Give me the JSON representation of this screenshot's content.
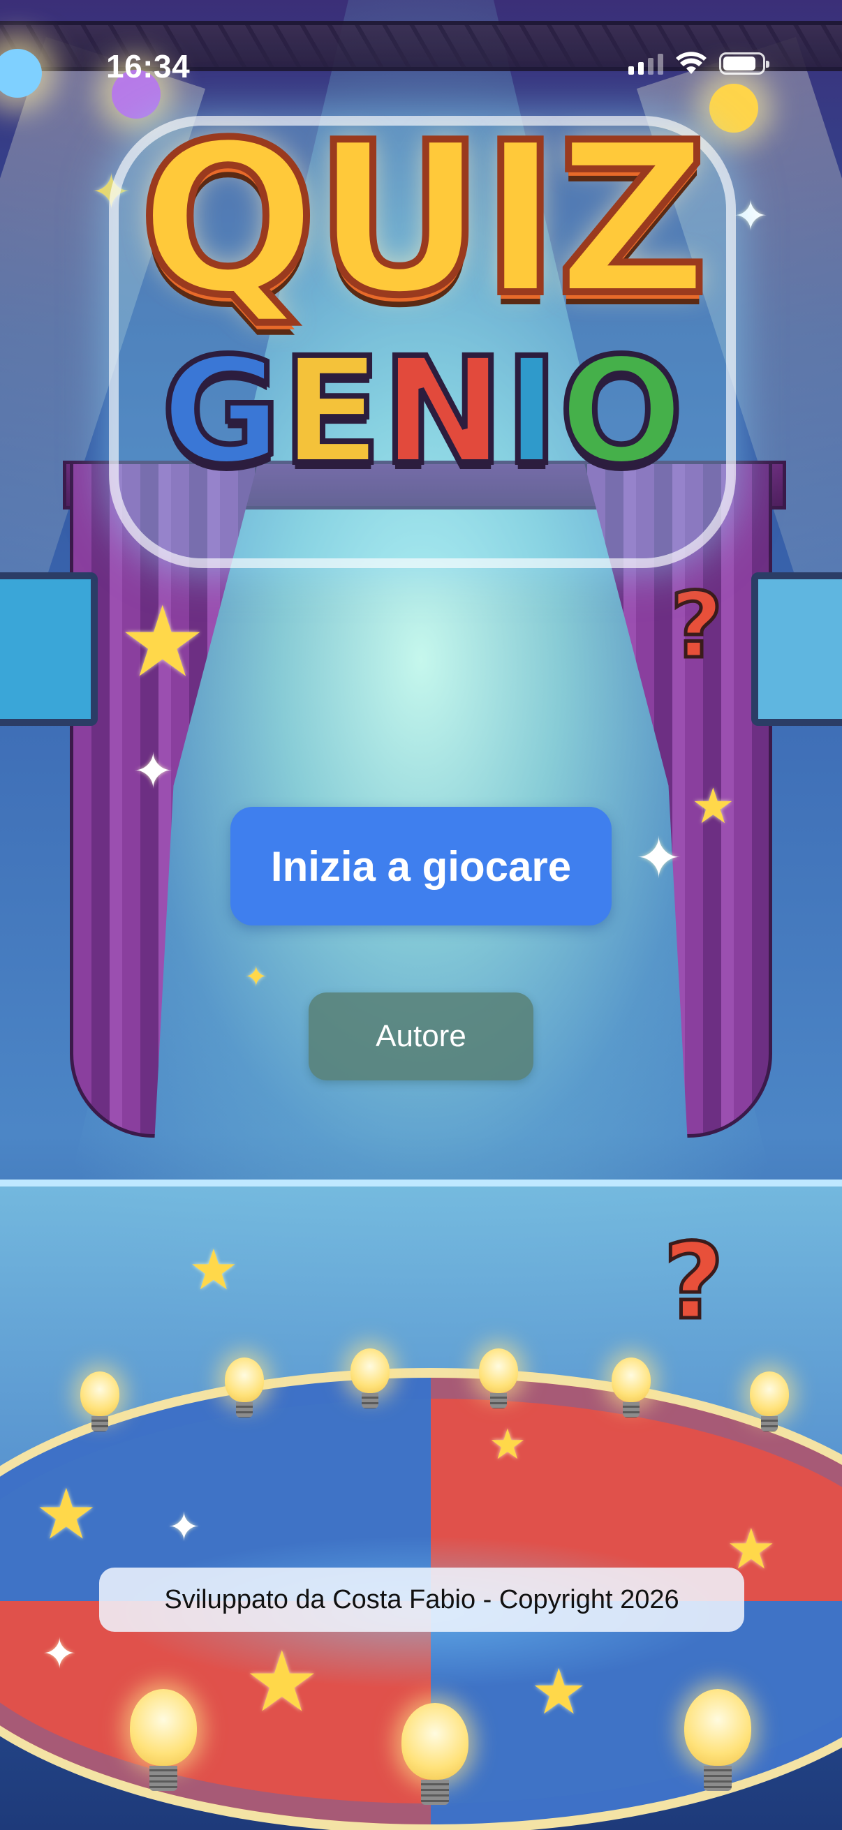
{
  "status_bar": {
    "time": "16:34",
    "icons": [
      "cellular-signal-icon",
      "wifi-icon",
      "battery-icon"
    ]
  },
  "logo": {
    "line1": "QUIZ",
    "line2_letters": [
      "G",
      "E",
      "N",
      "I",
      "O"
    ]
  },
  "buttons": {
    "play_label": "Inizia a giocare",
    "author_label": "Autore"
  },
  "footer": {
    "credit": "Sviluppato da Costa Fabio - Copyright 2026"
  },
  "colors": {
    "play_button": "#3f7fee",
    "author_button": "#588076",
    "footer_badge": "#f0f6ff",
    "logo_yellow": "#ffc93a"
  }
}
